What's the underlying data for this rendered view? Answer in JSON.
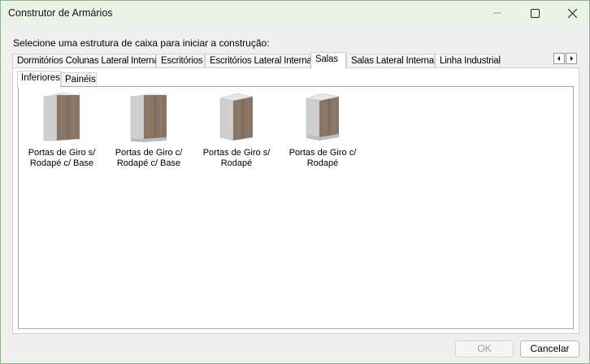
{
  "window": {
    "title": "Construtor de Armários"
  },
  "instruction": "Selecione uma estrutura de caixa para iniciar a construção:",
  "tabs": [
    {
      "label": "Dormitórios Colunas Lateral Interna"
    },
    {
      "label": "Escritórios"
    },
    {
      "label": "Escritórios Lateral Interna"
    },
    {
      "label": "Salas",
      "active": true
    },
    {
      "label": "Salas Lateral Interna"
    },
    {
      "label": "Linha Industrial"
    }
  ],
  "subtabs": [
    {
      "label": "Inferiores",
      "active": true
    },
    {
      "label": "Painéis"
    }
  ],
  "items": [
    {
      "line1": "Portas de Giro s/",
      "line2": "Rodapé c/ Base",
      "icon": "cabinet-icon"
    },
    {
      "line1": "Portas de Giro c/",
      "line2": "Rodapé c/ Base",
      "icon": "cabinet-icon"
    },
    {
      "line1": "Portas de Giro s/",
      "line2": "Rodapé",
      "icon": "cabinet-icon"
    },
    {
      "line1": "Portas de Giro c/",
      "line2": "Rodapé",
      "icon": "cabinet-icon"
    }
  ],
  "buttons": {
    "ok": "OK",
    "cancel": "Cancelar"
  },
  "colors": {
    "titlebar": "#eaf3e6",
    "wood": "#8a7565",
    "cabinet_side": "#cfcfcf"
  }
}
